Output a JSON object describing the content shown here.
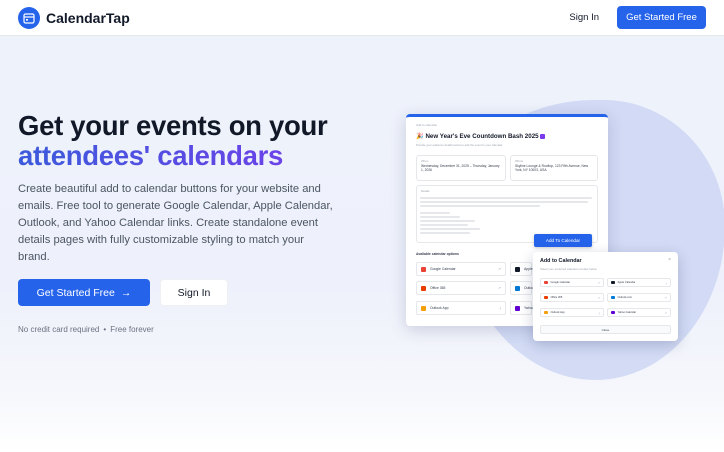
{
  "nav": {
    "brand": "CalendarTap",
    "sign_in": "Sign In",
    "cta": "Get Started Free"
  },
  "hero": {
    "headline_line1": "Get your events on your",
    "headline_line2": "attendees' calendars",
    "subtext": "Create beautiful add to calendar buttons for your website and emails. Free tool to generate Google Calendar, Apple Calendar, Outlook, and Yahoo Calendar links. Create standalone event details pages with fully customizable styling to match your brand.",
    "primary_button": "Get Started Free",
    "primary_button_arrow": "→",
    "secondary_button": "Sign In",
    "fineprint_1": "No credit card required",
    "fineprint_sep": "•",
    "fineprint_2": "Free forever"
  },
  "preview": {
    "crumb": "Add to calendar",
    "event_title": "New Year's Eve Countdown Bash 2025",
    "event_caption": "Provide your audience details below to add the event to your calendar",
    "when_label": "When",
    "when_text": "Wednesday, December 31, 2025 – Thursday, January 1, 2026",
    "where_label": "Where",
    "where_text": "Skyline Lounge & Rooftop, 123 Fifth Avenue, New York, NY 10003, USA",
    "details_label": "Details",
    "add_button": "Add To Calendar",
    "options_label": "Available calendar options",
    "options": [
      {
        "name": "Google Calendar",
        "color": "#ea4335"
      },
      {
        "name": "Apple",
        "color": "#111827"
      },
      {
        "name": "Office 365",
        "color": "#eb3c00"
      },
      {
        "name": "Outlook",
        "color": "#0078d4"
      },
      {
        "name": "Outlook App",
        "color": "#f59e0b"
      },
      {
        "name": "Yahoo",
        "color": "#6001d2"
      }
    ]
  },
  "popup": {
    "title": "Add to Calendar",
    "subtitle": "Select your preferred calendar provider below",
    "close_icon": "×",
    "options": [
      {
        "name": "Google Calendar",
        "color": "#ea4335"
      },
      {
        "name": "Apple Calendar",
        "color": "#111827"
      },
      {
        "name": "Office 365",
        "color": "#eb3c00"
      },
      {
        "name": "Outlook.com",
        "color": "#0078d4"
      },
      {
        "name": "Outlook App",
        "color": "#f59e0b"
      },
      {
        "name": "Yahoo Calendar",
        "color": "#6001d2"
      }
    ],
    "close_button": "Close"
  },
  "colors": {
    "brand": "#2563eb",
    "gradient_start": "#3b5bdb",
    "gradient_end": "#7c3aed"
  }
}
